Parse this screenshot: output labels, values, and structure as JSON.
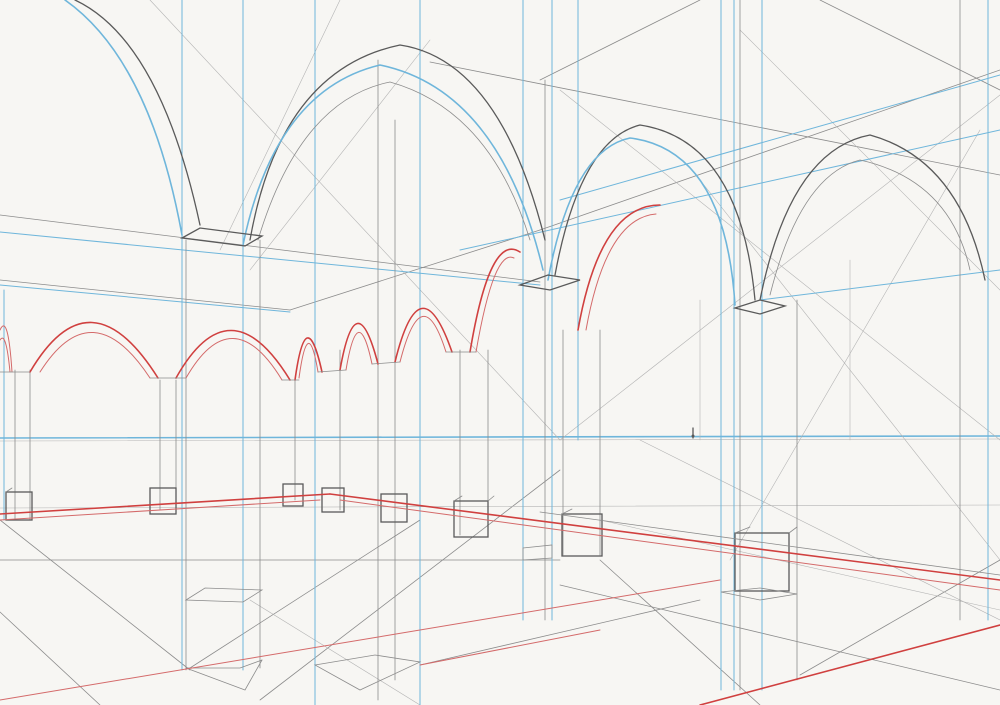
{
  "artwork": {
    "medium": "pencil-and-colored-pencil-perspective-sketch",
    "colors": {
      "paper": "#f7f6f3",
      "graphite": "#8c8c8c",
      "graphite_dark": "#5a5a5a",
      "horizon_blue": "#6fb6db",
      "construction_red": "#d0403f"
    }
  }
}
